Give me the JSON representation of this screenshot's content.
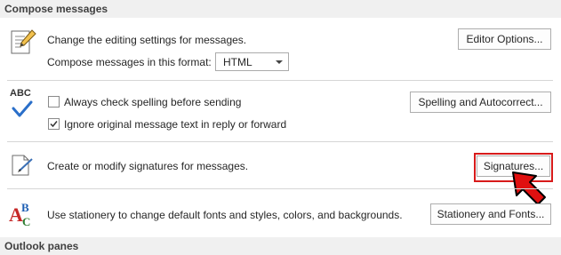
{
  "sections": {
    "compose_messages": "Compose messages",
    "outlook_panes": "Outlook panes"
  },
  "editing": {
    "text": "Change the editing settings for messages.",
    "button": "Editor Options...",
    "format_label": "Compose messages in this format:",
    "format_value": "HTML"
  },
  "spelling": {
    "abc_text": "ABC",
    "always_check": "Always check spelling before sending",
    "always_check_checked": false,
    "ignore_original": "Ignore original message text in reply or forward",
    "ignore_original_checked": true,
    "button": "Spelling and Autocorrect..."
  },
  "signatures": {
    "text": "Create or modify signatures for messages.",
    "button": "Signatures..."
  },
  "stationery": {
    "text": "Use stationery to change default fonts and styles, colors, and backgrounds.",
    "button": "Stationery and Fonts..."
  },
  "colors": {
    "highlight": "#d81b1b",
    "arrow": "#e01010"
  }
}
